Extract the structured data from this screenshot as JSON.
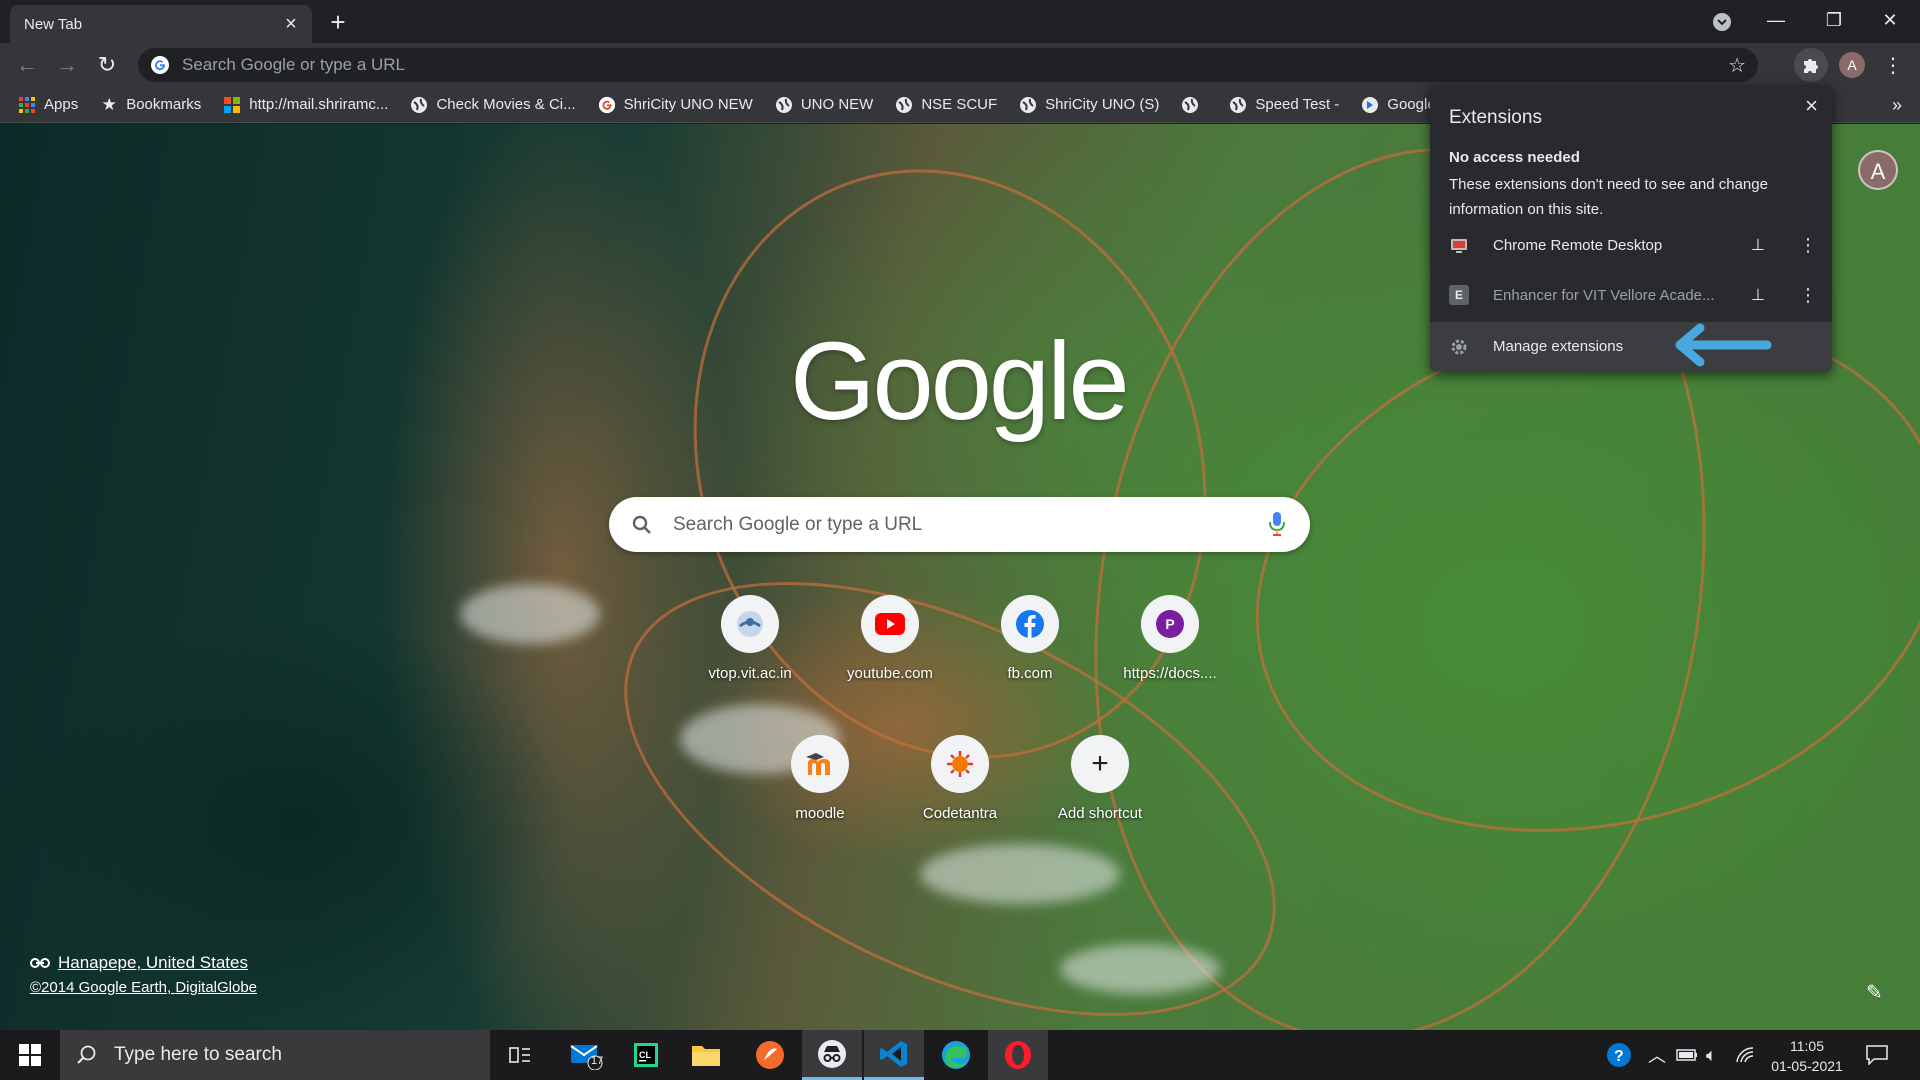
{
  "browser": {
    "tab_title": "New Tab",
    "omnibox_placeholder": "Search Google or type a URL",
    "profile_initial": "A"
  },
  "bookmarks": [
    {
      "label": "Apps",
      "icon": "apps-grid-icon"
    },
    {
      "label": "Bookmarks",
      "icon": "star-icon"
    },
    {
      "label": "http://mail.shriramc...",
      "icon": "microsoft-icon"
    },
    {
      "label": "Check Movies & Ci...",
      "icon": "globe-icon"
    },
    {
      "label": "ShriCity UNO NEW",
      "icon": "google-icon"
    },
    {
      "label": "UNO NEW",
      "icon": "globe-icon"
    },
    {
      "label": "NSE SCUF",
      "icon": "globe-icon"
    },
    {
      "label": "ShriCity UNO (S)",
      "icon": "globe-icon"
    },
    {
      "label": "",
      "icon": "globe-icon"
    },
    {
      "label": "Speed Test -",
      "icon": "globe-icon"
    },
    {
      "label": "Google",
      "icon": "arrow-circle-icon"
    }
  ],
  "newtab": {
    "logo_text": "Google",
    "search_placeholder": "Search Google or type a URL",
    "shortcuts_row1": [
      {
        "label": "vtop.vit.ac.in",
        "icon": "vtop-icon"
      },
      {
        "label": "youtube.com",
        "icon": "youtube-icon"
      },
      {
        "label": "fb.com",
        "icon": "facebook-icon"
      },
      {
        "label": "https://docs....",
        "icon": "letter-p-icon",
        "letter": "P"
      }
    ],
    "shortcuts_row2": [
      {
        "label": "moodle",
        "icon": "moodle-icon"
      },
      {
        "label": "Codetantra",
        "icon": "codetantra-icon"
      },
      {
        "label": "Add shortcut",
        "icon": "plus-icon"
      }
    ],
    "attribution_location": "Hanapepe, United States",
    "attribution_copyright": "©2014 Google Earth, DigitalGlobe",
    "profile_initial": "A"
  },
  "extensions_popup": {
    "title": "Extensions",
    "section_title": "No access needed",
    "section_desc": "These extensions don't need to see and change information on this site.",
    "items": [
      {
        "name": "Chrome Remote Desktop",
        "icon": "remote-desktop-icon"
      },
      {
        "name": "Enhancer for VIT Vellore Acade...",
        "icon": "letter-e-icon",
        "letter": "E"
      }
    ],
    "manage_label": "Manage extensions"
  },
  "taskbar": {
    "search_placeholder": "Type here to search",
    "mail_badge": "17",
    "time": "11:05",
    "date": "01-05-2021"
  },
  "colors": {
    "chrome_dark": "#202124",
    "toolbar": "#35363a",
    "popup_bg": "#292a2d",
    "annotation_arrow": "#4aa8e0"
  }
}
